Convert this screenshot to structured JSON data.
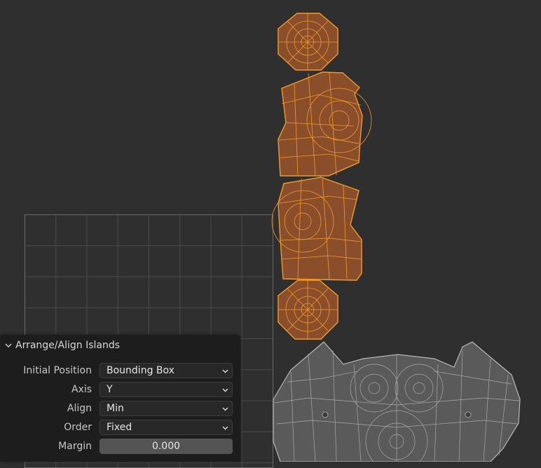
{
  "panel": {
    "title": "Arrange/Align Islands",
    "fields": [
      {
        "label": "Initial Position",
        "value": "Bounding Box",
        "kind": "dropdown"
      },
      {
        "label": "Axis",
        "value": "Y",
        "kind": "dropdown"
      },
      {
        "label": "Align",
        "value": "Min",
        "kind": "dropdown"
      },
      {
        "label": "Order",
        "value": "Fixed",
        "kind": "dropdown"
      },
      {
        "label": "Margin",
        "value": "0.000",
        "kind": "number"
      }
    ]
  },
  "colors": {
    "background": "#2f2f2f",
    "selected_island_fill": "#8a4f2a",
    "selected_island_edge": "#f39a2b",
    "unselected_island_fill": "#5a5a5a",
    "unselected_island_edge": "#b8b8b8",
    "panel_bg": "#1d1d1d"
  },
  "icons": {
    "panel_toggle": "chevron-down-icon",
    "dropdown_arrow": "chevron-down-icon"
  }
}
